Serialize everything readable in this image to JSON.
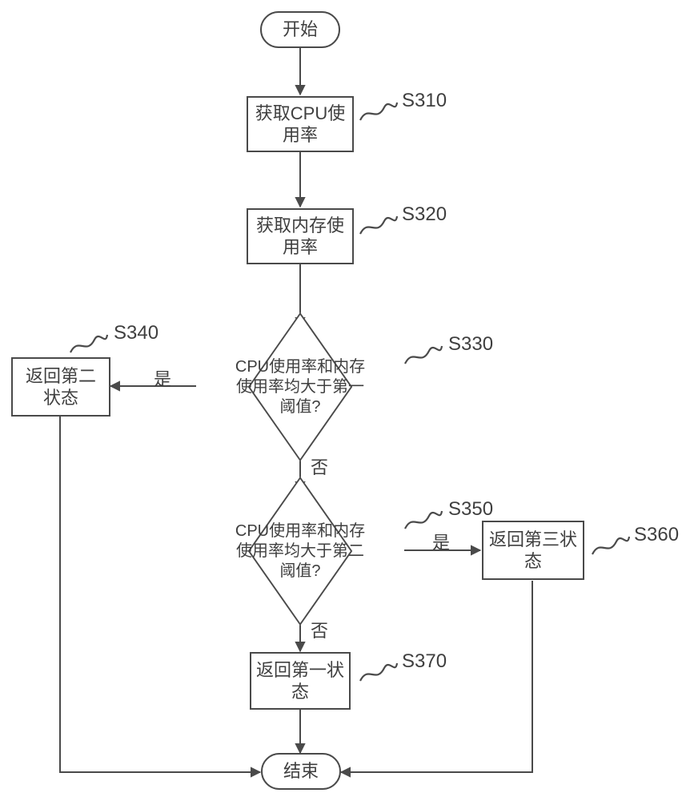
{
  "chart_data": {
    "type": "flowchart",
    "title": "",
    "nodes": [
      {
        "id": "start",
        "shape": "terminator",
        "label": "开始"
      },
      {
        "id": "s310",
        "shape": "process",
        "label": "获取CPU使用率",
        "step": "S310"
      },
      {
        "id": "s320",
        "shape": "process",
        "label": "获取内存使用率",
        "step": "S320"
      },
      {
        "id": "s330",
        "shape": "decision",
        "label": "CPU使用率和内存使用率均大于第一阈值?",
        "step": "S330"
      },
      {
        "id": "s340",
        "shape": "process",
        "label": "返回第二状态",
        "step": "S340"
      },
      {
        "id": "s350",
        "shape": "decision",
        "label": "CPU使用率和内存使用率均大于第二阈值?",
        "step": "S350"
      },
      {
        "id": "s360",
        "shape": "process",
        "label": "返回第三状态",
        "step": "S360"
      },
      {
        "id": "s370",
        "shape": "process",
        "label": "返回第一状态",
        "step": "S370"
      },
      {
        "id": "end",
        "shape": "terminator",
        "label": "结束"
      }
    ],
    "edges": [
      {
        "from": "start",
        "to": "s310"
      },
      {
        "from": "s310",
        "to": "s320"
      },
      {
        "from": "s320",
        "to": "s330"
      },
      {
        "from": "s330",
        "to": "s340",
        "label": "是"
      },
      {
        "from": "s330",
        "to": "s350",
        "label": "否"
      },
      {
        "from": "s350",
        "to": "s360",
        "label": "是"
      },
      {
        "from": "s350",
        "to": "s370",
        "label": "否"
      },
      {
        "from": "s340",
        "to": "end"
      },
      {
        "from": "s360",
        "to": "end"
      },
      {
        "from": "s370",
        "to": "end"
      }
    ],
    "edge_labels": {
      "yes": "是",
      "no": "否"
    }
  }
}
